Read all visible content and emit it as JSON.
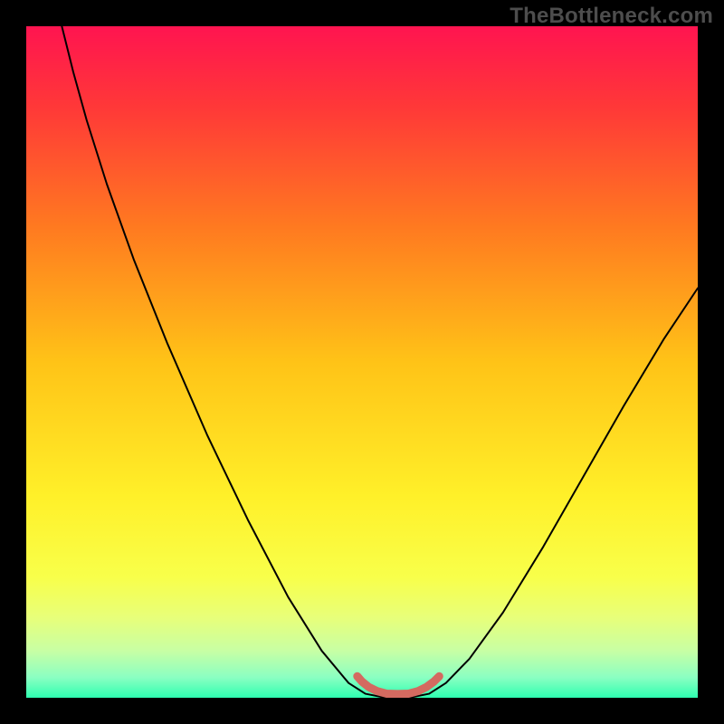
{
  "watermark": {
    "text": "TheBottleneck.com"
  },
  "chart_data": {
    "type": "line",
    "title": "",
    "xlabel": "",
    "ylabel": "",
    "xlim": [
      0,
      100
    ],
    "ylim": [
      0,
      100
    ],
    "grid": false,
    "legend": false,
    "background_gradient_stops": [
      {
        "offset": 0.0,
        "color": "#ff1450"
      },
      {
        "offset": 0.12,
        "color": "#ff3838"
      },
      {
        "offset": 0.3,
        "color": "#ff7a20"
      },
      {
        "offset": 0.5,
        "color": "#ffc317"
      },
      {
        "offset": 0.7,
        "color": "#fff029"
      },
      {
        "offset": 0.82,
        "color": "#f8ff4a"
      },
      {
        "offset": 0.88,
        "color": "#e8ff79"
      },
      {
        "offset": 0.93,
        "color": "#c8ffa4"
      },
      {
        "offset": 0.97,
        "color": "#8affc2"
      },
      {
        "offset": 1.0,
        "color": "#2effb0"
      }
    ],
    "series": [
      {
        "name": "bottleneck-curve",
        "color": "#000000",
        "stroke_width": 2,
        "points": [
          {
            "x": 5.3,
            "y": 100.0
          },
          {
            "x": 6.0,
            "y": 97.2
          },
          {
            "x": 7.0,
            "y": 93.2
          },
          {
            "x": 9.0,
            "y": 86.0
          },
          {
            "x": 12.0,
            "y": 76.5
          },
          {
            "x": 16.0,
            "y": 65.3
          },
          {
            "x": 21.0,
            "y": 52.8
          },
          {
            "x": 27.0,
            "y": 39.0
          },
          {
            "x": 33.0,
            "y": 26.5
          },
          {
            "x": 39.0,
            "y": 15.0
          },
          {
            "x": 44.0,
            "y": 7.0
          },
          {
            "x": 48.0,
            "y": 2.2
          },
          {
            "x": 50.5,
            "y": 0.6
          },
          {
            "x": 53.5,
            "y": 0.0
          },
          {
            "x": 57.0,
            "y": 0.0
          },
          {
            "x": 60.0,
            "y": 0.6
          },
          {
            "x": 62.5,
            "y": 2.2
          },
          {
            "x": 66.0,
            "y": 5.8
          },
          {
            "x": 71.0,
            "y": 12.7
          },
          {
            "x": 77.0,
            "y": 22.5
          },
          {
            "x": 83.0,
            "y": 33.0
          },
          {
            "x": 89.0,
            "y": 43.5
          },
          {
            "x": 95.0,
            "y": 53.5
          },
          {
            "x": 100.0,
            "y": 61.0
          }
        ]
      },
      {
        "name": "optimal-range-marker",
        "color": "#d46a60",
        "stroke_width": 9,
        "points": [
          {
            "x": 49.3,
            "y": 3.2
          },
          {
            "x": 50.0,
            "y": 2.4
          },
          {
            "x": 51.0,
            "y": 1.6
          },
          {
            "x": 52.2,
            "y": 1.0
          },
          {
            "x": 53.7,
            "y": 0.6
          },
          {
            "x": 55.3,
            "y": 0.55
          },
          {
            "x": 56.9,
            "y": 0.6
          },
          {
            "x": 58.4,
            "y": 1.0
          },
          {
            "x": 59.6,
            "y": 1.6
          },
          {
            "x": 60.7,
            "y": 2.4
          },
          {
            "x": 61.5,
            "y": 3.2
          }
        ]
      }
    ]
  }
}
